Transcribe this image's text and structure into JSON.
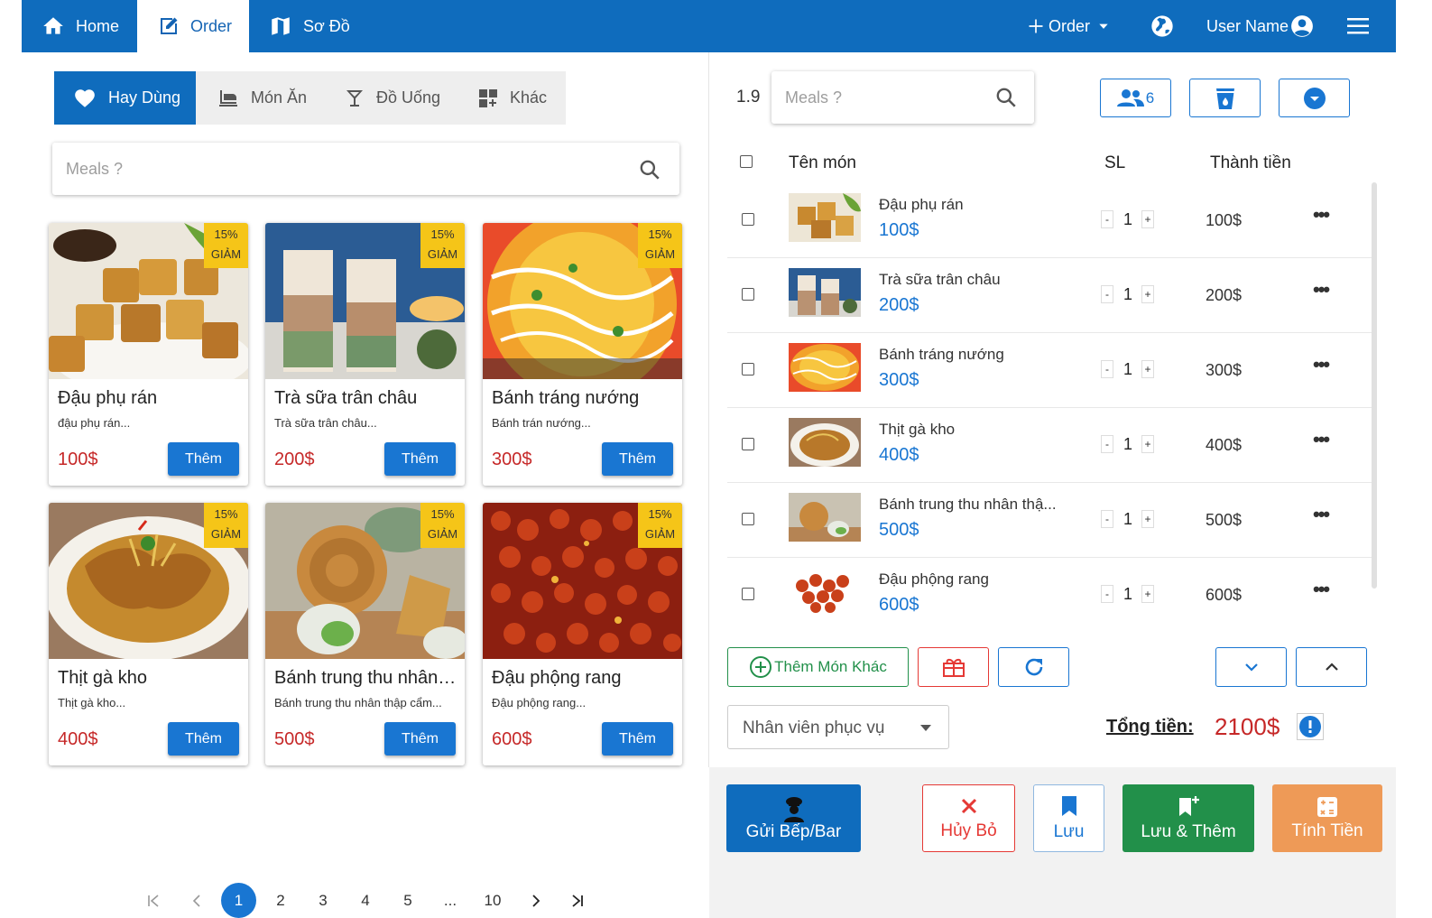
{
  "nav": {
    "home": "Home",
    "order": "Order",
    "map": "Sơ Đồ",
    "add_order": "Order",
    "user": "User Name"
  },
  "categories": [
    "Hay Dùng",
    "Món Ăn",
    "Đồ Uống",
    "Khác"
  ],
  "menu_search_placeholder": "Meals ?",
  "order_search_placeholder": "Meals ?",
  "table_number": "1.9",
  "guest_count": "6",
  "badge": {
    "pct": "15%",
    "label": "GIẢM"
  },
  "add_button": "Thêm",
  "menu_items": [
    {
      "name": "Đậu phụ rán",
      "desc": "đậu phụ rán...",
      "price": "100$"
    },
    {
      "name": "Trà sữa trân châu",
      "desc": "Trà sữa trân châu...",
      "price": "200$"
    },
    {
      "name": "Bánh tráng nướng",
      "desc": "Bánh trán nướng...",
      "price": "300$"
    },
    {
      "name": "Thịt gà kho",
      "desc": "Thịt gà kho...",
      "price": "400$"
    },
    {
      "name": "Bánh trung thu nhân thập cẩm",
      "desc": "Bánh trung thu nhân thập cẩm...",
      "price": "500$"
    },
    {
      "name": "Đậu phộng rang",
      "desc": "Đậu phộng rang...",
      "price": "600$"
    }
  ],
  "pagination": [
    "1",
    "2",
    "3",
    "4",
    "5",
    "...",
    "10"
  ],
  "order_table": {
    "headers": {
      "name": "Tên món",
      "qty": "SL",
      "total": "Thành tiền"
    },
    "rows": [
      {
        "name": "Đậu phụ rán",
        "price": "100$",
        "qty": "1",
        "total": "100$"
      },
      {
        "name": "Trà sữa trân châu",
        "price": "200$",
        "qty": "1",
        "total": "200$"
      },
      {
        "name": "Bánh tráng nướng",
        "price": "300$",
        "qty": "1",
        "total": "300$"
      },
      {
        "name": "Thịt gà kho",
        "price": "400$",
        "qty": "1",
        "total": "400$"
      },
      {
        "name": "Bánh trung thu nhân thậ...",
        "price": "500$",
        "qty": "1",
        "total": "500$"
      },
      {
        "name": "Đậu phộng rang",
        "price": "600$",
        "qty": "1",
        "total": "600$"
      }
    ]
  },
  "add_other_item": "Thêm Món Khác",
  "staff_select": "Nhân viên phục vụ",
  "total_label": "Tổng tiền:",
  "total_value": "2100$",
  "actions": {
    "send_kitchen": "Gửi Bếp/Bar",
    "cancel": "Hủy Bỏ",
    "save": "Lưu",
    "save_add": "Lưu & Thêm",
    "checkout": "Tính Tiền"
  },
  "colors": {
    "primary": "#0f6cbd",
    "price_red": "#c62828",
    "badge": "#f5c518",
    "green": "#22904a",
    "orange": "#ee9a57"
  }
}
